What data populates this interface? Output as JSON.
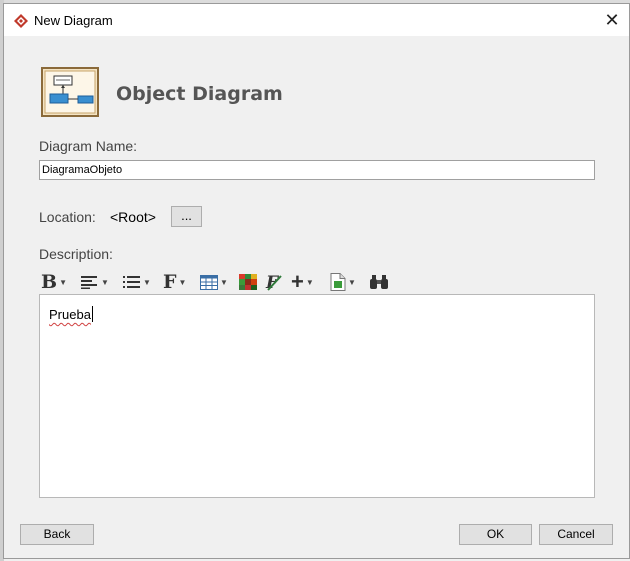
{
  "window": {
    "title": "New Diagram"
  },
  "header": {
    "title": "Object Diagram",
    "icon": "object-diagram-icon"
  },
  "diagram_name": {
    "label": "Diagram Name:",
    "value": "DiagramaObjeto"
  },
  "location": {
    "label": "Location:",
    "value": "<Root>",
    "browse_label": "..."
  },
  "description": {
    "label": "Description:",
    "text": "Prueba",
    "toolbar": [
      "bold",
      "align",
      "list",
      "font",
      "table",
      "color",
      "formula",
      "insert",
      "document",
      "find"
    ]
  },
  "buttons": {
    "back": "Back",
    "ok": "OK",
    "cancel": "Cancel"
  },
  "colors": {
    "accent": "#c0392b",
    "title_text": "#555555"
  }
}
